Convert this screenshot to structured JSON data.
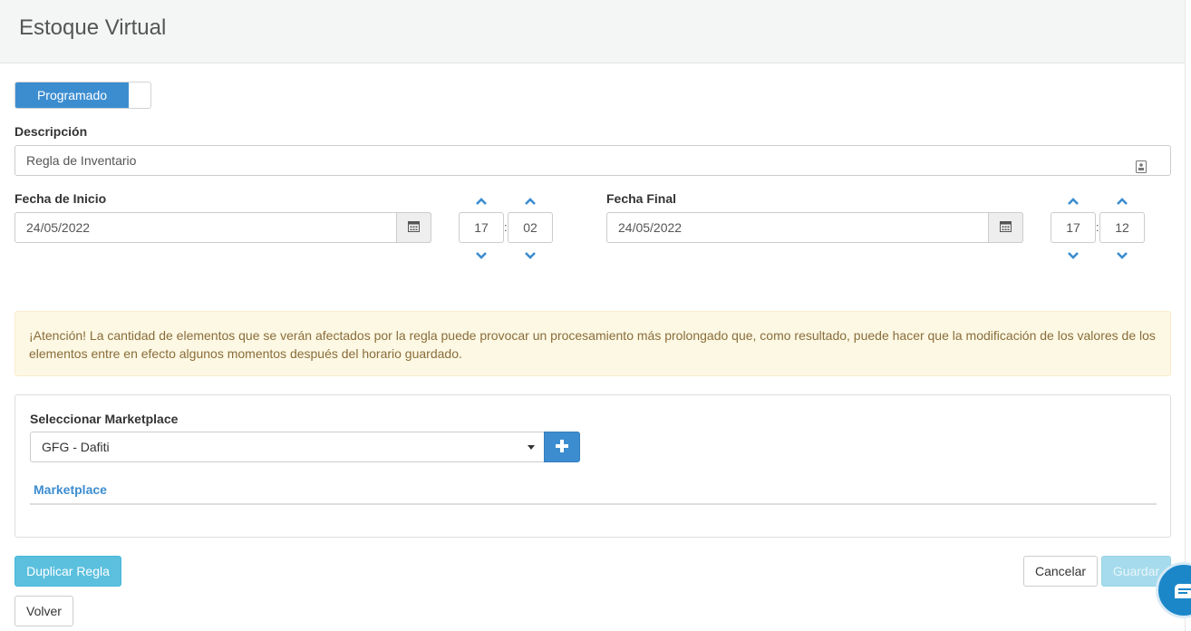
{
  "header": {
    "title": "Estoque Virtual"
  },
  "mode_toggle": {
    "label": "Programado"
  },
  "description": {
    "label": "Descripción",
    "value": "Regla de Inventario",
    "icon": "contact-card-icon"
  },
  "start": {
    "label": "Fecha de Inicio",
    "date": "24/05/2022",
    "hour": "17",
    "minute": "02",
    "separator": ":"
  },
  "end": {
    "label": "Fecha Final",
    "date": "24/05/2022",
    "hour": "17",
    "minute": "12",
    "separator": ":"
  },
  "alert": {
    "text": "¡Atención! La cantidad de elementos que se verán afectados por la regla puede provocar un procesamiento más prolongado que, como resultado, puede hacer que la modificación de los valores de los elementos entre en efecto algunos momentos después del horario guardado."
  },
  "marketplace": {
    "label": "Seleccionar Marketplace",
    "selected": "GFG - Dafiti",
    "table_header": "Marketplace"
  },
  "actions": {
    "duplicate": "Duplicar Regla",
    "cancel": "Cancelar",
    "save": "Guardar",
    "back": "Volver"
  },
  "colors": {
    "primary": "#3c8dd0",
    "info": "#5bc0de",
    "alert_bg": "#fcf8e3",
    "alert_text": "#8a6d3b",
    "chat": "#1b87c9"
  }
}
